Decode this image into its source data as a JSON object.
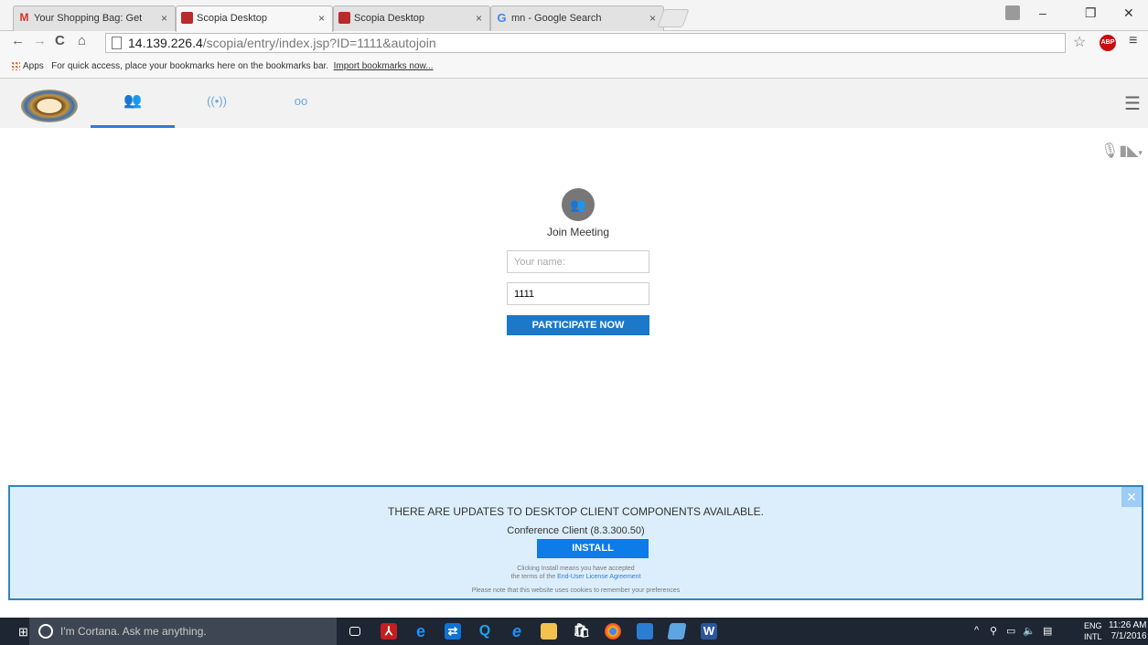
{
  "browser": {
    "tabs": [
      {
        "title": "Your Shopping Bag: Get",
        "favicon": "gmail-icon",
        "active": false
      },
      {
        "title": "Scopia Desktop",
        "favicon": "scopia-icon",
        "active": true
      },
      {
        "title": "Scopia Desktop",
        "favicon": "scopia-icon",
        "active": false
      },
      {
        "title": "mn - Google Search",
        "favicon": "google-icon",
        "active": false
      }
    ],
    "close_glyph": "×",
    "url_host": "14.139.226.4",
    "url_path": "/scopia/entry/index.jsp?ID=1111&autojoin",
    "bookmarks": {
      "apps_label": "Apps",
      "hint": "For quick access, place your bookmarks here on the bookmarks bar.",
      "import_link": "Import bookmarks now..."
    }
  },
  "app": {
    "nav_tabs": [
      {
        "icon": "participants-icon",
        "glyph": "👥",
        "active": true
      },
      {
        "icon": "broadcast-icon",
        "glyph": "((•))",
        "active": false
      },
      {
        "icon": "voicemail-icon",
        "glyph": "oo",
        "active": false
      }
    ],
    "menu_glyph": "☰"
  },
  "join": {
    "title": "Join Meeting",
    "name_placeholder": "Your name:",
    "name_value": "",
    "meeting_id_value": "1111",
    "button_label": "PARTICIPATE NOW"
  },
  "banner": {
    "title": "THERE ARE UPDATES TO DESKTOP CLIENT COMPONENTS AVAILABLE.",
    "component": "Conference Client (8.3.300.50)",
    "install_label": "INSTALL",
    "note_line1": "Clicking Install means you have accepted",
    "note_line2_prefix": "the terms of the",
    "eula_link": "End-User License Agreement",
    "cookie_note": "Please note that this website uses cookies to remember your preferences"
  },
  "taskbar": {
    "cortana_placeholder": "I'm Cortana. Ask me anything.",
    "lang_top": "ENG",
    "lang_bottom": "INTL",
    "time": "11:26 AM",
    "date": "7/1/2016",
    "pinned": [
      {
        "icon": "task-view-icon",
        "color": "#1d2632"
      },
      {
        "icon": "acrobat-icon",
        "color": "#c41e1e"
      },
      {
        "icon": "edge-icon",
        "color": "#1e90ff"
      },
      {
        "icon": "teamviewer-icon",
        "color": "#0e73d6"
      },
      {
        "icon": "quora-search-icon",
        "color": "#1ea1f2"
      },
      {
        "icon": "internet-explorer-icon",
        "color": "#1e90ff"
      },
      {
        "icon": "file-explorer-icon",
        "color": "#f2c14e"
      },
      {
        "icon": "store-icon",
        "color": "#ffffff"
      },
      {
        "icon": "chrome-icon",
        "color": "#e8a33d"
      },
      {
        "icon": "outlook-icon",
        "color": "#2b7cd3"
      },
      {
        "icon": "app-icon",
        "color": "#5da5e0"
      },
      {
        "icon": "word-icon",
        "color": "#2b579a"
      }
    ]
  }
}
